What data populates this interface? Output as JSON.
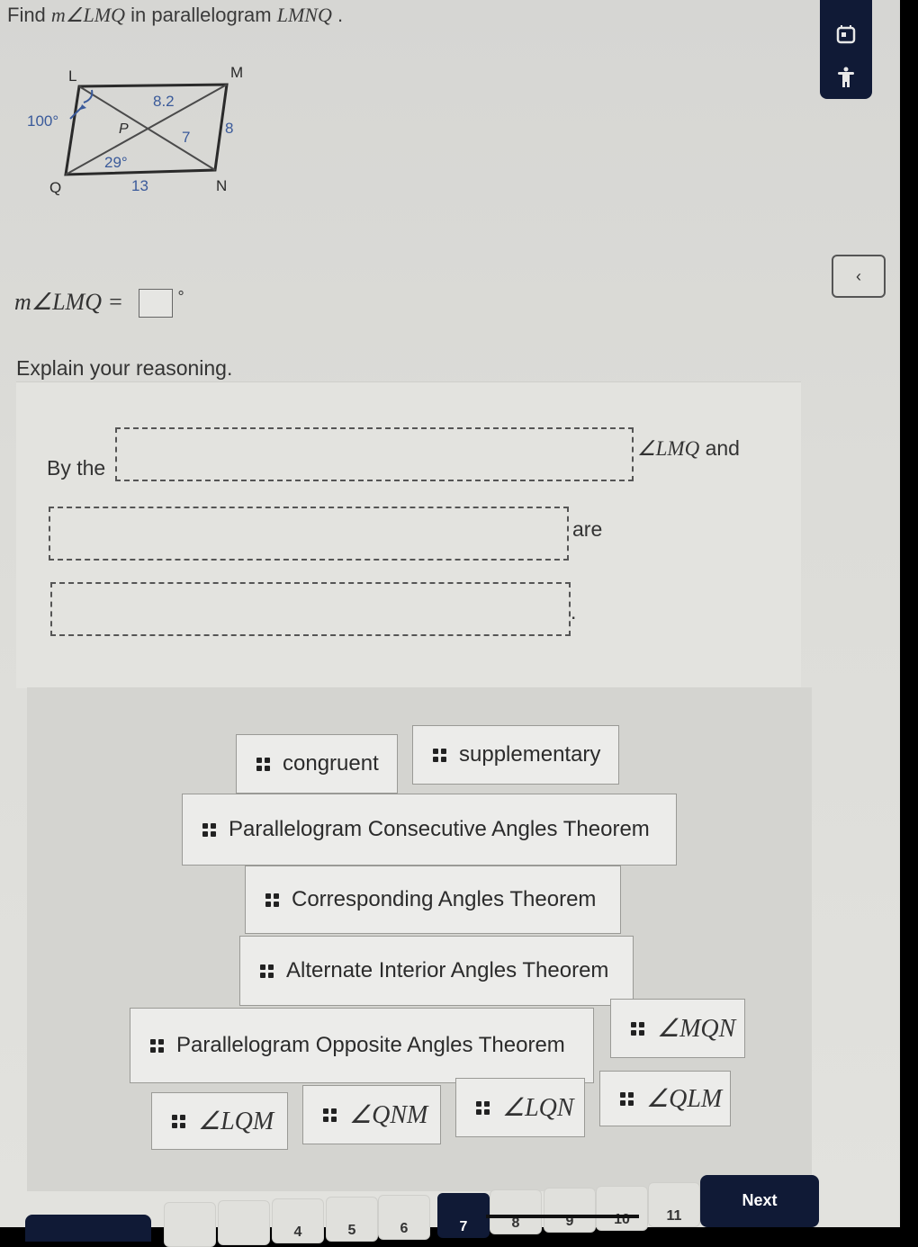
{
  "question": {
    "prefix": "Find ",
    "angle": "m∠LMQ",
    "suffix": " in parallelogram ",
    "shape": "LMNQ",
    "end": " ."
  },
  "figure": {
    "vertices": {
      "L": "L",
      "M": "M",
      "N": "N",
      "Q": "Q",
      "P": "P"
    },
    "labels": {
      "angle_L": "100°",
      "segment_MP": "8.2",
      "segment_PN": "7",
      "side_MN": "8",
      "angle_MQN": "29°",
      "side_QN": "13"
    },
    "colors": {
      "label": "#3a5a9a",
      "lines": "#2a2a2a"
    }
  },
  "side_toolbar": {
    "icons": [
      "calendar-icon",
      "accessibility-icon"
    ],
    "background": "#101a36"
  },
  "collapse_button": {
    "label": "‹"
  },
  "answer": {
    "lhs": "m∠LMQ",
    "equals": " = ",
    "value": "",
    "unit": "°"
  },
  "explain_label": "Explain your reasoning.",
  "sentence": {
    "part1": "By the",
    "part2_angle": "∠LMQ",
    "part2_text": " and",
    "part3": "are",
    "part4": ".",
    "drop_zones": [
      "",
      "",
      ""
    ]
  },
  "bank": {
    "tiles": [
      {
        "text": "congruent",
        "math": false
      },
      {
        "text": "supplementary",
        "math": false
      },
      {
        "text": "Parallelogram Consecutive Angles Theorem",
        "math": false
      },
      {
        "text": "Corresponding Angles Theorem",
        "math": false
      },
      {
        "text": "Alternate Interior Angles Theorem",
        "math": false
      },
      {
        "text": "Parallelogram Opposite Angles Theorem",
        "math": false
      },
      {
        "text": "∠MQN",
        "math": true
      },
      {
        "text": "∠LQM",
        "math": true
      },
      {
        "text": "∠QNM",
        "math": true
      },
      {
        "text": "∠LQN",
        "math": true
      },
      {
        "text": "∠QLM",
        "math": true
      }
    ]
  },
  "pagination": {
    "pages": [
      "",
      "",
      "4",
      "5",
      "6",
      "7",
      "8",
      "9",
      "10",
      "11"
    ],
    "current": "7",
    "next_label": "Next"
  }
}
